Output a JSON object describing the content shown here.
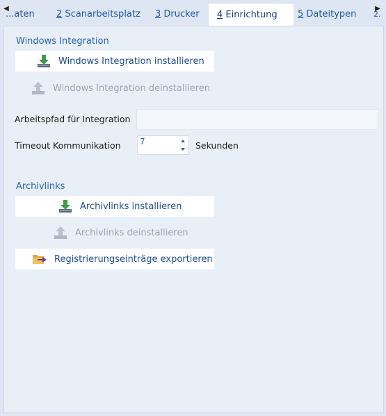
{
  "tabs": [
    {
      "key": "",
      "label": "...aten"
    },
    {
      "key": "2",
      "label": " Scanarbeitsplatz"
    },
    {
      "key": "3",
      "label": " Drucker"
    },
    {
      "key": "4",
      "label": " Einrichtung"
    },
    {
      "key": "5",
      "label": " Dateitypen"
    }
  ],
  "tab_overflow": "2.",
  "windows_integration": {
    "title": "Windows Integration",
    "install_label": "Windows Integration installieren",
    "uninstall_label": "Windows Integration deinstallieren"
  },
  "fields": {
    "work_path_label": "Arbeitspfad für Integration",
    "work_path_value": "",
    "timeout_label": "Timeout Kommunikation",
    "timeout_value": "7",
    "timeout_unit": "Sekunden"
  },
  "archivlinks": {
    "title": "Archivlinks",
    "install_label": "Archivlinks installieren",
    "uninstall_label": "Archivlinks deinstallieren",
    "export_label": "Registrierungseinträge exportieren"
  },
  "colors": {
    "accent": "#2a63b0",
    "install_icon": "#3f9a4a",
    "disabled": "#9aa5b3",
    "export_icon": "#e0a93a"
  }
}
